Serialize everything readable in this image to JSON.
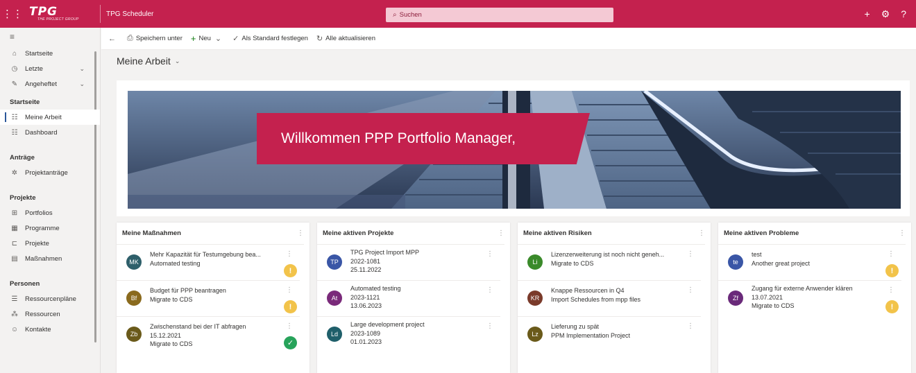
{
  "topbar": {
    "logo_text": "TPG",
    "logo_sub": "THE PROJECT GROUP",
    "app_title": "TPG Scheduler",
    "search_placeholder": "Suchen"
  },
  "commands": {
    "back": "←",
    "save_as": "Speichern unter",
    "new": "Neu",
    "set_default": "Als Standard festlegen",
    "refresh_all": "Alle aktualisieren"
  },
  "sidebar": {
    "home": "Startseite",
    "recent": "Letzte",
    "pinned": "Angeheftet",
    "sections": [
      {
        "title": "Startseite",
        "items": [
          "Meine Arbeit",
          "Dashboard"
        ]
      },
      {
        "title": "Anträge",
        "items": [
          "Projektanträge"
        ]
      },
      {
        "title": "Projekte",
        "items": [
          "Portfolios",
          "Programme",
          "Projekte",
          "Maßnahmen"
        ]
      },
      {
        "title": "Personen",
        "items": [
          "Ressourcenpläne",
          "Ressourcen",
          "Kontakte"
        ]
      }
    ]
  },
  "page": {
    "title": "Meine Arbeit",
    "welcome": "Willkommen PPP Portfolio Manager,"
  },
  "cards": [
    {
      "title": "Meine Maßnahmen",
      "rows": [
        {
          "initials": "MK",
          "color": "#2e5f6a",
          "lines": [
            "Mehr Kapazität für Testumgebung bea...",
            "Automated testing"
          ],
          "status": "warning"
        },
        {
          "initials": "Bf",
          "color": "#8a6a1d",
          "lines": [
            "Budget für PPP beantragen",
            "Migrate to CDS"
          ],
          "status": "warning"
        },
        {
          "initials": "Zb",
          "color": "#6a5a1a",
          "lines": [
            "Zwischenstand bei der IT abfragen",
            "15.12.2021",
            "Migrate to CDS"
          ],
          "status": "done"
        }
      ]
    },
    {
      "title": "Meine aktiven Projekte",
      "rows": [
        {
          "initials": "TP",
          "color": "#3a56a6",
          "lines": [
            "TPG Project Import MPP",
            "2022-1081",
            "25.11.2022"
          ],
          "status": ""
        },
        {
          "initials": "At",
          "color": "#7a2a7a",
          "lines": [
            "Automated testing",
            "2023-1121",
            "13.06.2023"
          ],
          "status": ""
        },
        {
          "initials": "Ld",
          "color": "#1f5f6a",
          "lines": [
            "Large development project",
            "2023-1089",
            "01.01.2023"
          ],
          "status": ""
        }
      ]
    },
    {
      "title": "Meine aktiven Risiken",
      "rows": [
        {
          "initials": "Li",
          "color": "#3a8a2a",
          "lines": [
            "Lizenzerweiterung ist noch nicht geneh...",
            "Migrate to CDS"
          ],
          "status": ""
        },
        {
          "initials": "KR",
          "color": "#7a3a2a",
          "lines": [
            "Knappe Ressourcen in Q4",
            "Import Schedules from mpp files"
          ],
          "status": ""
        },
        {
          "initials": "Lz",
          "color": "#6a5a1a",
          "lines": [
            "Lieferung zu spät",
            "PPM Implementation Project"
          ],
          "status": ""
        }
      ]
    },
    {
      "title": "Meine aktiven Probleme",
      "rows": [
        {
          "initials": "te",
          "color": "#3a56a6",
          "lines": [
            "test",
            "Another great project"
          ],
          "status": "warning"
        },
        {
          "initials": "Zf",
          "color": "#6a2a7a",
          "lines": [
            "Zugang für externe Anwender klären",
            "13.07.2021",
            "Migrate to CDS"
          ],
          "status": "warning"
        }
      ]
    }
  ]
}
